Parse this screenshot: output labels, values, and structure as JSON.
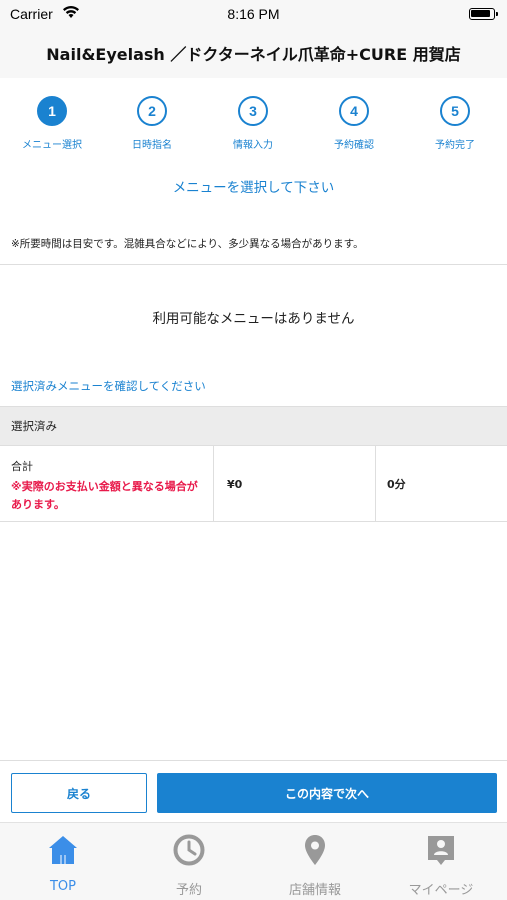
{
  "status_bar": {
    "carrier": "Carrier",
    "time": "8:16 PM"
  },
  "header": {
    "title": "Nail&Eyelash ／ドクターネイル爪革命+CURE 用賀店"
  },
  "steps": [
    {
      "number": "1",
      "label": "メニュー選択",
      "active": true
    },
    {
      "number": "2",
      "label": "日時指名",
      "active": false
    },
    {
      "number": "3",
      "label": "情報入力",
      "active": false
    },
    {
      "number": "4",
      "label": "予約確認",
      "active": false
    },
    {
      "number": "5",
      "label": "予約完了",
      "active": false
    }
  ],
  "prompt": "メニューを選択して下さい",
  "note": "※所要時間は目安です。混雑具合などにより、多少異なる場合があります。",
  "empty_message": "利用可能なメニューはありません",
  "check_link": "選択済みメニューを確認してください",
  "selected": {
    "heading": "選択済み",
    "total_label": "合計",
    "warning": "※実際のお支払い金額と異なる場合があります。",
    "price": "¥0",
    "duration": "0分"
  },
  "actions": {
    "back_label": "戻る",
    "next_label": "この内容で次へ"
  },
  "tabbar": [
    {
      "label": "TOP",
      "icon": "home-icon",
      "active": true
    },
    {
      "label": "予約",
      "icon": "clock-icon",
      "active": false
    },
    {
      "label": "店舗情報",
      "icon": "location-pin-icon",
      "active": false
    },
    {
      "label": "マイページ",
      "icon": "profile-icon",
      "active": false
    }
  ],
  "colors": {
    "accent": "#1a82d0",
    "warning": "#e8194a",
    "tab_active": "#3b8ee8",
    "tab_inactive": "#999999"
  }
}
